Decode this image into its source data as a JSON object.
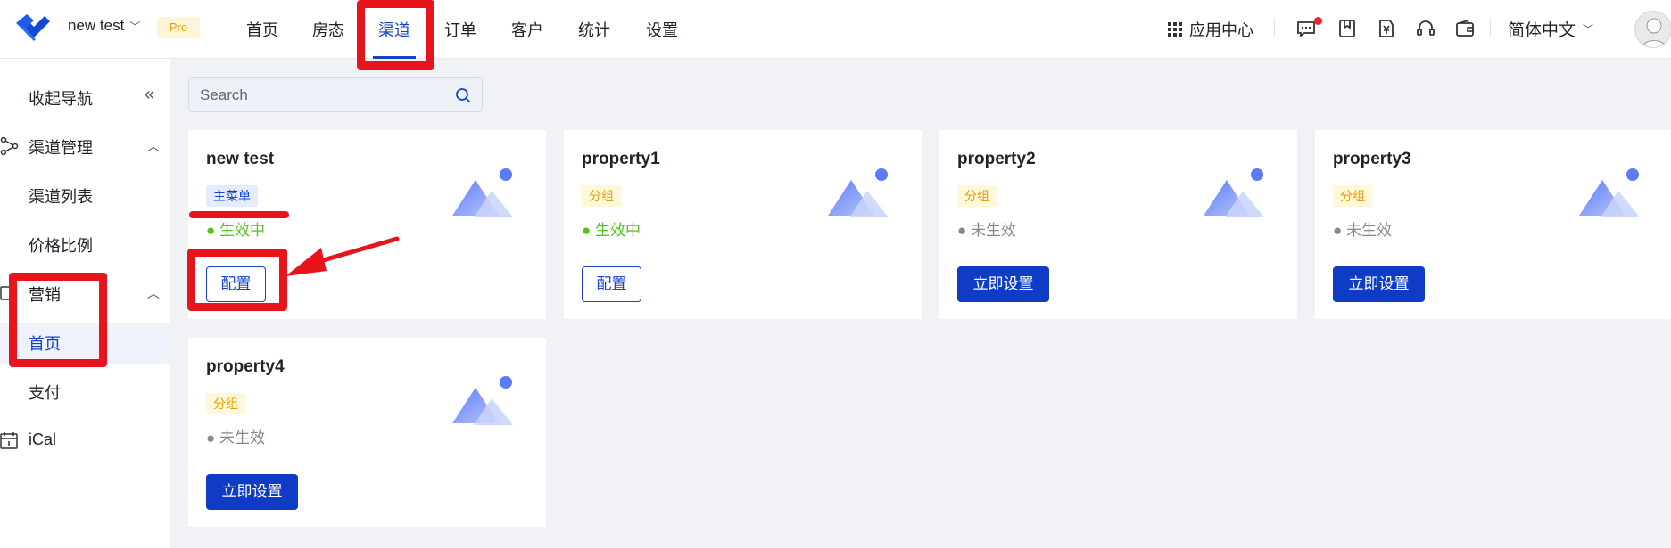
{
  "header": {
    "project_name": "new test",
    "project_badge": "Pro",
    "nav": [
      {
        "label": "首页"
      },
      {
        "label": "房态"
      },
      {
        "label": "渠道"
      },
      {
        "label": "订单"
      },
      {
        "label": "客户"
      },
      {
        "label": "统计"
      },
      {
        "label": "设置"
      }
    ],
    "active_nav": "渠道",
    "app_center": "应用中心",
    "language": "简体中文"
  },
  "sidebar": {
    "collapse_label": "收起导航",
    "groups": [
      {
        "label": "渠道管理",
        "items": [
          {
            "label": "渠道列表"
          },
          {
            "label": "价格比例"
          }
        ]
      },
      {
        "label": "营销",
        "items": [
          {
            "label": "首页"
          },
          {
            "label": "支付"
          }
        ]
      },
      {
        "label": "iCal",
        "items": []
      }
    ],
    "active_item": "首页"
  },
  "search": {
    "placeholder": "Search",
    "value": ""
  },
  "cards": [
    {
      "title": "new test",
      "tag": "主菜单",
      "status": "● 生效中",
      "button": "配置"
    },
    {
      "title": "property1",
      "tag": "分组",
      "status": "● 生效中",
      "button": "配置"
    },
    {
      "title": "property2",
      "tag": "分组",
      "status": "● 未生效",
      "button": "立即设置"
    },
    {
      "title": "property3",
      "tag": "分组",
      "status": "● 未生效",
      "button": "立即设置"
    },
    {
      "title": "property4",
      "tag": "分组",
      "status": "● 未生效",
      "button": "立即设置"
    }
  ],
  "colors": {
    "primary": "#0e3cc7",
    "active_text": "#1742c8",
    "success": "#52c41a",
    "annotation": "#e8141b"
  }
}
